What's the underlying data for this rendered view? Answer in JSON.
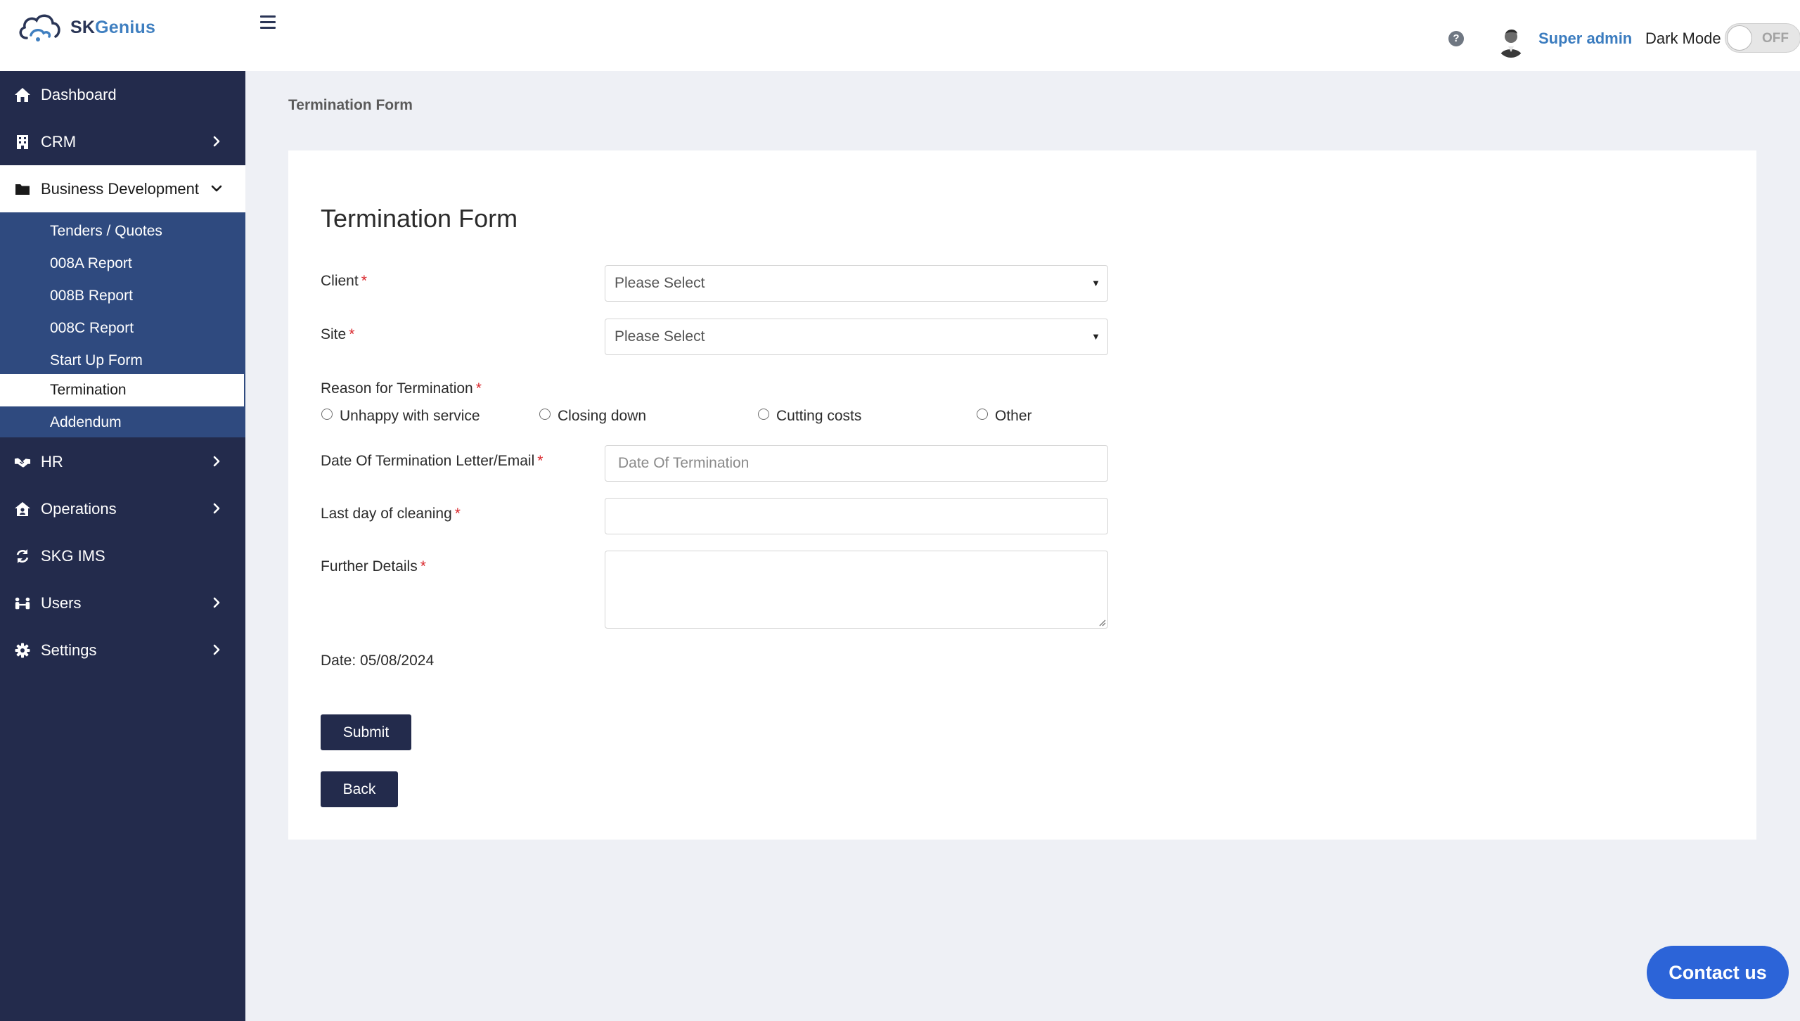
{
  "brand": {
    "name_part1": "SK",
    "name_part2": "Genius"
  },
  "header": {
    "user_name": "Super admin",
    "dark_mode_label": "Dark Mode",
    "toggle_state": "OFF"
  },
  "sidebar": {
    "items": [
      {
        "label": "Dashboard"
      },
      {
        "label": "CRM"
      },
      {
        "label": "Business Development"
      },
      {
        "label": "HR"
      },
      {
        "label": "Operations"
      },
      {
        "label": "SKG IMS"
      },
      {
        "label": "Users"
      },
      {
        "label": "Settings"
      }
    ],
    "submenu": [
      {
        "label": "Tenders / Quotes"
      },
      {
        "label": "008A Report"
      },
      {
        "label": "008B Report"
      },
      {
        "label": "008C Report"
      },
      {
        "label": "Start Up Form"
      },
      {
        "label": "Termination"
      },
      {
        "label": "Addendum"
      }
    ]
  },
  "breadcrumb": "Termination Form",
  "form": {
    "title": "Termination Form",
    "client_label": "Client",
    "client_value": "Please Select",
    "site_label": "Site",
    "site_value": "Please Select",
    "reason_label": "Reason for Termination",
    "reasons": [
      "Unhappy with service",
      "Closing down",
      "Cutting costs",
      "Other"
    ],
    "date_letter_label": "Date Of Termination Letter/Email",
    "date_letter_placeholder": "Date Of Termination",
    "last_day_label": "Last day of cleaning",
    "last_day_value": "",
    "further_label": "Further Details",
    "required_mark": "*",
    "date_text": "Date: 05/08/2024",
    "submit_label": "Submit",
    "back_label": "Back"
  },
  "contact_label": "Contact us",
  "colors": {
    "sidebar_bg": "#232b4c",
    "submenu_bg": "#2f4a7f",
    "accent_link": "#3b7cbf",
    "required": "#d9262b",
    "contact_bg": "#2c64d8"
  }
}
